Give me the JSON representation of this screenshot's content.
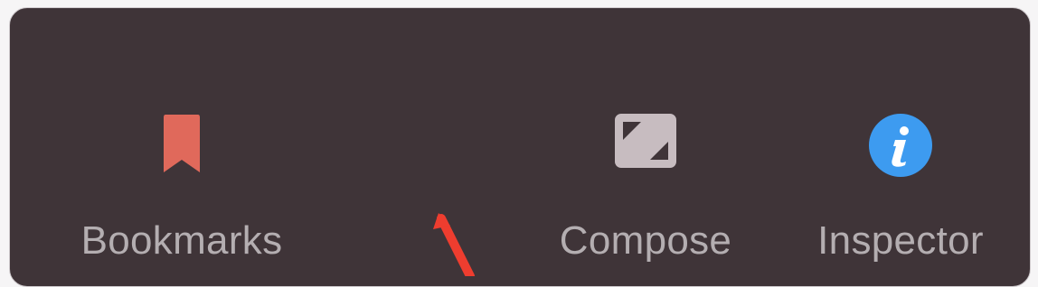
{
  "toolbar": {
    "items": [
      {
        "label": "Bookmarks",
        "icon": "bookmark-icon",
        "color": "#e0695b"
      },
      {
        "label": "Compose",
        "icon": "compose-expand-icon",
        "color": "#c7bcc0"
      },
      {
        "label": "Inspector",
        "icon": "info-icon",
        "color": "#3d9bf0"
      }
    ]
  },
  "annotation": {
    "arrow_color": "#ee3d2f"
  }
}
